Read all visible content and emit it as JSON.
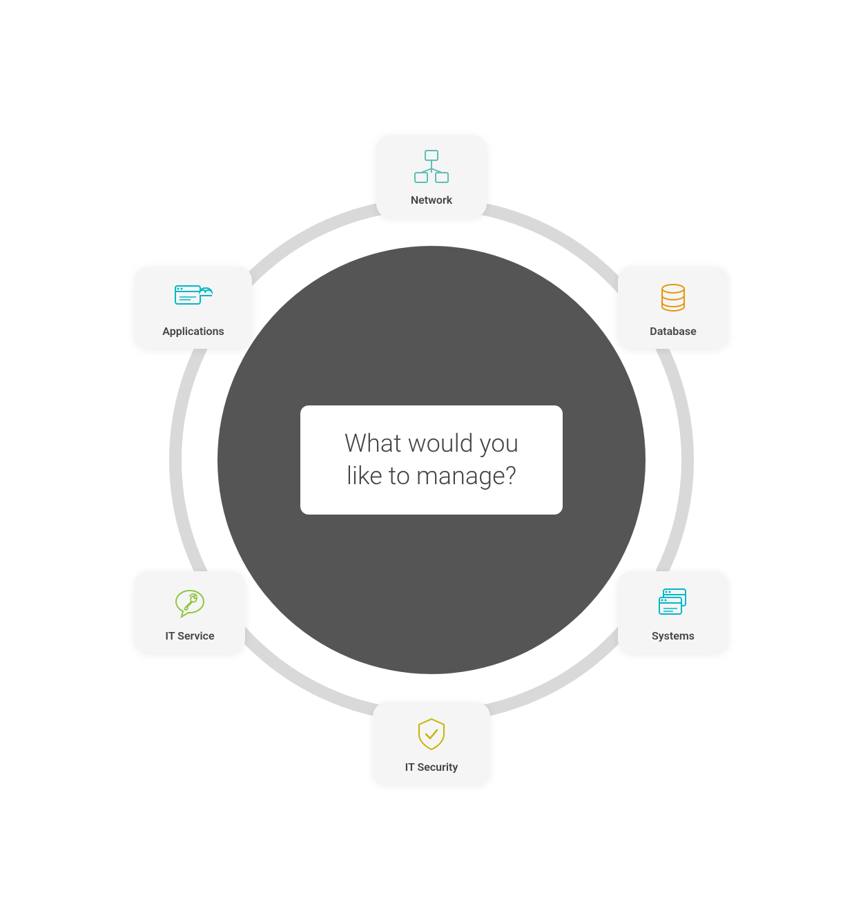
{
  "diagram": {
    "center_question": "What would you like to manage?",
    "nodes": [
      {
        "id": "network",
        "label": "Network",
        "icon": "network-icon",
        "color": "#5bbfb5"
      },
      {
        "id": "database",
        "label": "Database",
        "icon": "database-icon",
        "color": "#e8960c"
      },
      {
        "id": "systems",
        "label": "Systems",
        "icon": "systems-icon",
        "color": "#00b8c8"
      },
      {
        "id": "itsecurity",
        "label": "IT Security",
        "icon": "shield-icon",
        "color": "#c8b400"
      },
      {
        "id": "itservice",
        "label": "IT Service",
        "icon": "wrench-icon",
        "color": "#8dc63f"
      },
      {
        "id": "applications",
        "label": "Applications",
        "icon": "apps-icon",
        "color": "#00b8c8"
      }
    ]
  }
}
